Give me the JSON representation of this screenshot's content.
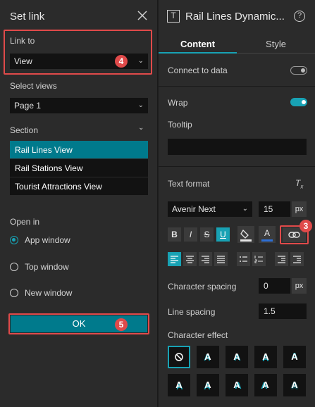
{
  "dialog": {
    "title": "Set link",
    "link_to_label": "Link to",
    "link_to_value": "View",
    "select_views_label": "Select views",
    "select_views_value": "Page 1",
    "section_label": "Section",
    "sections": [
      "Rail Lines View",
      "Rail Stations View",
      "Tourist Attractions View"
    ],
    "open_in_label": "Open in",
    "open_in_options": [
      "App window",
      "Top window",
      "New window"
    ],
    "ok_label": "OK"
  },
  "badges": {
    "b3": "3",
    "b4": "4",
    "b5": "5"
  },
  "panel": {
    "widget_title": "Rail Lines Dynamic...",
    "tabs": [
      "Content",
      "Style"
    ],
    "connect_to_data": "Connect to data",
    "wrap": "Wrap",
    "tooltip": "Tooltip",
    "text_format": "Text format",
    "font_name": "Avenir Next",
    "font_size": "15",
    "font_unit": "px",
    "character_spacing_label": "Character spacing",
    "character_spacing_value": "0",
    "character_spacing_unit": "px",
    "line_spacing_label": "Line spacing",
    "line_spacing_value": "1.5",
    "character_effect": "Character effect",
    "format_buttons": [
      "B",
      "I",
      "S",
      "U"
    ],
    "effect_letter": "A"
  },
  "colors": {
    "accent": "#18a2b4",
    "selected": "#007a8c",
    "highlight": "#e04a4a"
  }
}
